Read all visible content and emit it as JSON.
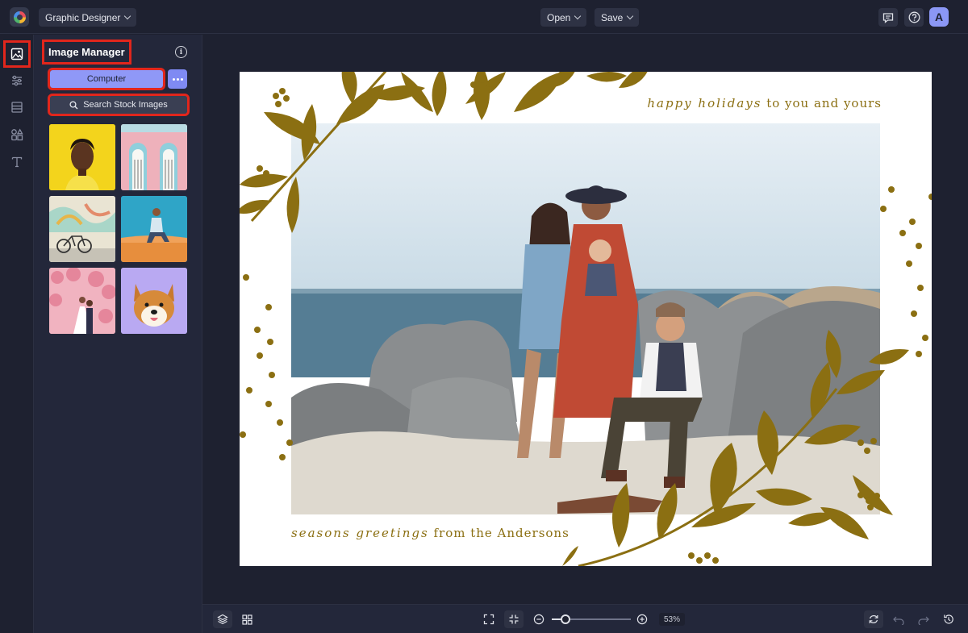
{
  "header": {
    "app_mode": "Graphic Designer",
    "open_label": "Open",
    "save_label": "Save",
    "avatar_initial": "A"
  },
  "rail": {
    "items": [
      {
        "icon": "image-icon",
        "active": true
      },
      {
        "icon": "adjustments-icon",
        "active": false
      },
      {
        "icon": "layout-icon",
        "active": false
      },
      {
        "icon": "shapes-icon",
        "active": false
      },
      {
        "icon": "text-icon",
        "active": false
      }
    ]
  },
  "panel": {
    "title": "Image Manager",
    "computer_label": "Computer",
    "search_label": "Search Stock Images",
    "thumbnails": [
      "woman in yellow portrait",
      "pink building with arched doors",
      "bicycle by mural wall",
      "man sitting on sand",
      "couple under pink blossoms",
      "shiba inu dog"
    ]
  },
  "card": {
    "top_script": "happy holidays",
    "top_plain": "to you and yours",
    "bottom_script": "seasons greetings",
    "bottom_plain": "from the Andersons",
    "accent_color": "#8b6f12"
  },
  "footer": {
    "zoom_label": "53%",
    "zoom_level": 0.17
  },
  "colors": {
    "accent": "#8f98f7",
    "highlight": "#e1261c",
    "background": "#1e2130"
  }
}
